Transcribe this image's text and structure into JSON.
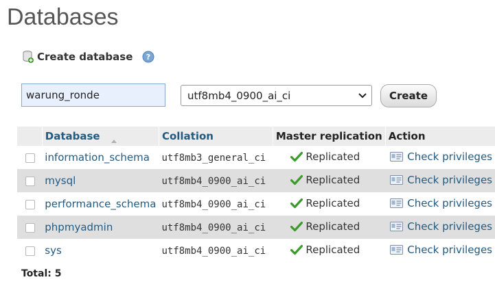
{
  "page": {
    "title": "Databases"
  },
  "create": {
    "heading": "Create database",
    "name_value": "warung_ronde",
    "collation_selected": "utf8mb4_0900_ai_ci",
    "button_label": "Create"
  },
  "table": {
    "headers": {
      "database": "Database",
      "collation": "Collation",
      "master_replication": "Master replication",
      "action": "Action"
    },
    "rows": [
      {
        "name": "information_schema",
        "collation": "utf8mb3_general_ci",
        "replication": "Replicated",
        "action": "Check privileges"
      },
      {
        "name": "mysql",
        "collation": "utf8mb4_0900_ai_ci",
        "replication": "Replicated",
        "action": "Check privileges"
      },
      {
        "name": "performance_schema",
        "collation": "utf8mb4_0900_ai_ci",
        "replication": "Replicated",
        "action": "Check privileges"
      },
      {
        "name": "phpmyadmin",
        "collation": "utf8mb4_0900_ai_ci",
        "replication": "Replicated",
        "action": "Check privileges"
      },
      {
        "name": "sys",
        "collation": "utf8mb4_0900_ai_ci",
        "replication": "Replicated",
        "action": "Check privileges"
      }
    ],
    "total": "Total: 5"
  },
  "icons": {
    "create": "database-plus-icon",
    "help": "help-icon",
    "sort": "sort-ascending-icon",
    "replicated": "check-icon",
    "privileges": "privileges-icon",
    "select_arrow": "chevron-down-icon"
  },
  "colors": {
    "link": "#235a81",
    "row_alt": "#dfdfdf",
    "header_bg": "#ececec",
    "check_green": "#3c9a2a",
    "input_bg": "#e8f0fe"
  }
}
